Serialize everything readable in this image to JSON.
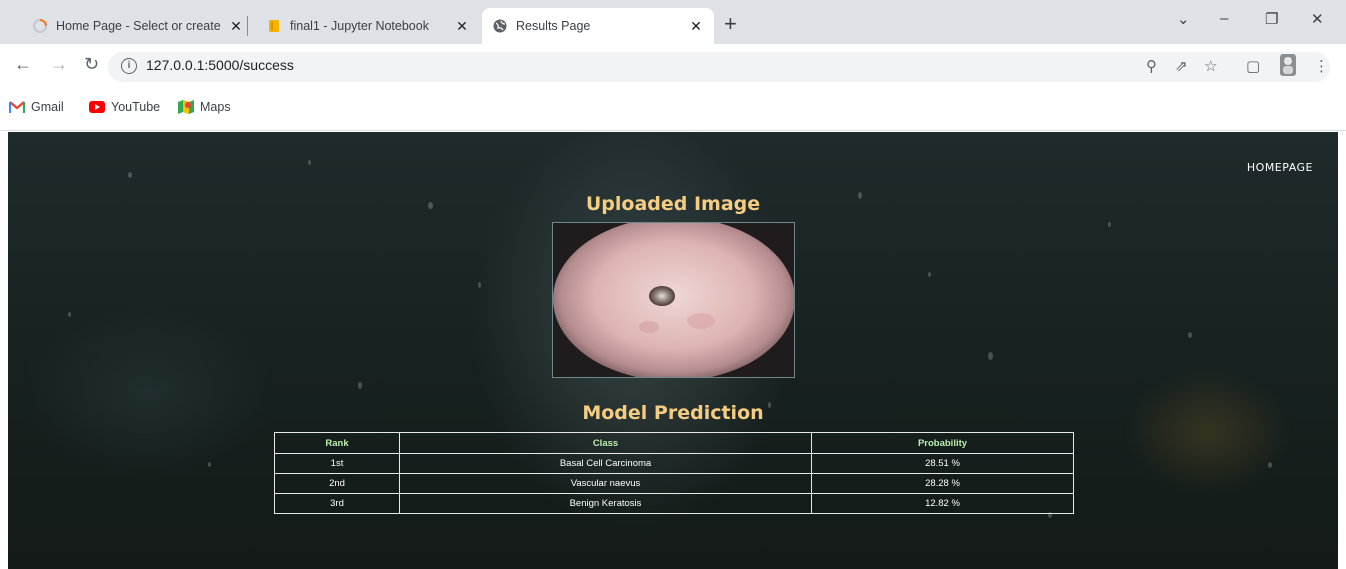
{
  "browser": {
    "tabs": [
      {
        "title": "Home Page - Select or create a n",
        "favicon": "spinner-icon",
        "active": false
      },
      {
        "title": "final1 - Jupyter Notebook",
        "favicon": "notebook-icon",
        "active": false
      },
      {
        "title": "Results Page",
        "favicon": "globe-icon",
        "active": true
      }
    ],
    "new_tab": "+",
    "url": "127.0.0.1:5000/success",
    "bookmarks": [
      {
        "label": "Gmail",
        "icon": "gmail-icon"
      },
      {
        "label": "YouTube",
        "icon": "youtube-icon"
      },
      {
        "label": "Maps",
        "icon": "maps-icon"
      }
    ]
  },
  "page": {
    "nav_link": "HOMEPAGE",
    "uploaded_heading": "Uploaded Image",
    "prediction_heading": "Model Prediction",
    "table": {
      "headers": [
        "Rank",
        "Class",
        "Probability"
      ],
      "rows": [
        [
          "1st",
          "Basal Cell Carcinoma",
          "28.51 %"
        ],
        [
          "2nd",
          "Vascular naevus",
          "28.28 %"
        ],
        [
          "3rd",
          "Benign Keratosis",
          "12.82 %"
        ]
      ]
    }
  },
  "colors": {
    "heading": "#f5cd82",
    "table_header": "#b9efb0",
    "page_bg": "#17211f"
  }
}
